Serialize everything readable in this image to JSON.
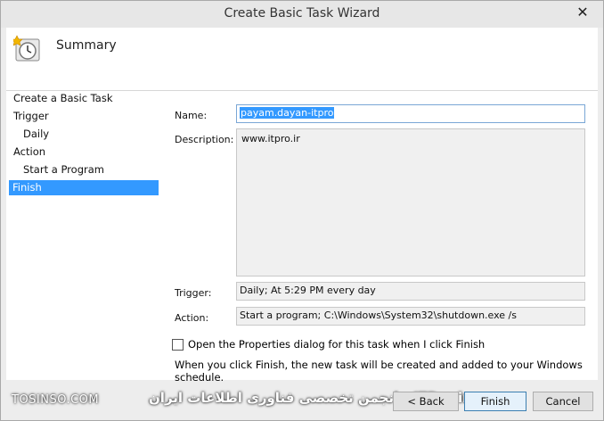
{
  "window": {
    "title": "Create Basic Task Wizard",
    "close_glyph": "✕"
  },
  "header": {
    "icon": "clock-task-icon",
    "title": "Summary"
  },
  "steps": [
    {
      "label": "Create a Basic Task"
    },
    {
      "label": "Trigger"
    },
    {
      "label": "Daily"
    },
    {
      "label": "Action"
    },
    {
      "label": "Start a Program"
    },
    {
      "label": "Finish"
    }
  ],
  "form": {
    "name_label": "Name:",
    "name_value": "payam.dayan-itpro",
    "description_label": "Description:",
    "description_value": "www.itpro.ir",
    "trigger_label": "Trigger:",
    "trigger_value": "Daily; At 5:29 PM every day",
    "action_label": "Action:",
    "action_value": "Start a program; C:\\Windows\\System32\\shutdown.exe /s",
    "open_properties_label": "Open the Properties dialog for this task when I click Finish",
    "open_properties_checked": false,
    "info_text": "When you click Finish, the new task will be created and added to your Windows schedule."
  },
  "footer": {
    "watermark_left": "TOSINSO.COM",
    "watermark_right": "ITPro.ir - انجمن تخصصی فناوری اطلاعات ایران",
    "back_button": "< Back",
    "finish_button": "Finish",
    "cancel_button": "Cancel"
  },
  "colors": {
    "selection": "#3399ff",
    "primary_button_border": "#3c7fb1"
  }
}
